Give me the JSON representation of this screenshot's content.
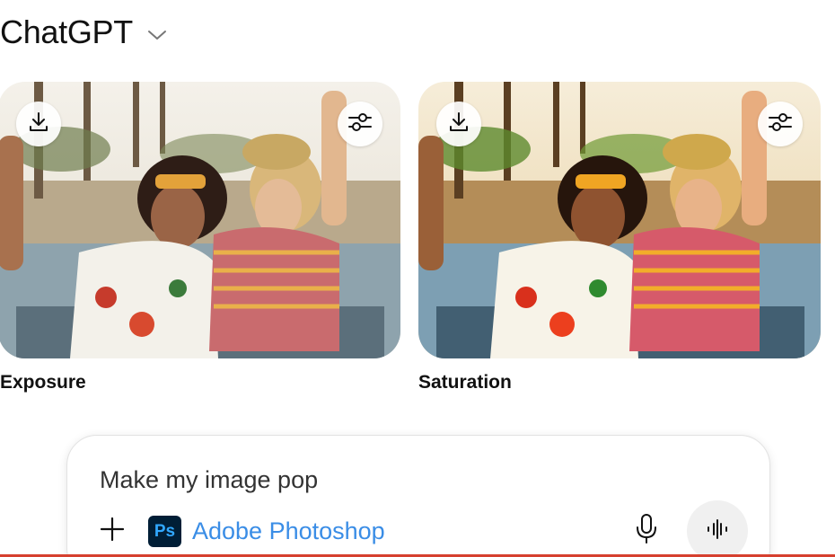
{
  "header": {
    "title": "ChatGPT",
    "chevron_icon": "chevron-down-icon"
  },
  "results": [
    {
      "caption": "Exposure",
      "download_icon": "download-icon",
      "adjust_icon": "sliders-icon"
    },
    {
      "caption": "Saturation",
      "download_icon": "download-icon",
      "adjust_icon": "sliders-icon"
    }
  ],
  "composer": {
    "prompt_text": "Make my image pop",
    "add_icon": "plus-icon",
    "app_chip": {
      "logo_text": "Ps",
      "name": "Adobe Photoshop"
    },
    "mic_icon": "microphone-icon",
    "voice_icon": "voice-mode-icon"
  },
  "colors": {
    "accent_link": "#3a8de6",
    "ps_bg": "#001e36",
    "ps_fg": "#31a8ff",
    "bottom_line": "#d6402f"
  }
}
